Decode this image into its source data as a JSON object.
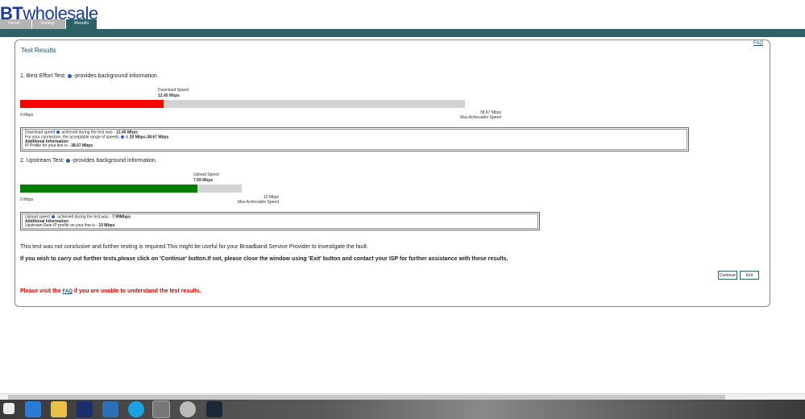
{
  "brand": {
    "prefix": "BT",
    "name": "wholesale"
  },
  "tabs": [
    {
      "label": "Home"
    },
    {
      "label": "Testing"
    },
    {
      "label": "Results"
    }
  ],
  "faq_link": "FAQ",
  "title": "Test Results",
  "best_effort": {
    "heading": "1. Best Effort Test:",
    "heading_suffix": "-provides background information.",
    "speed_label": "Download Speed",
    "speed_value": "12.45 Mbps",
    "min_label": "0 Mbps",
    "max_value": "38.67 Mbps",
    "max_label": "Max Achievable Speed",
    "fill_fraction": 0.322,
    "fill_color": "#ff0000",
    "info": {
      "line1_a": "Download speed",
      "line1_b": "achieved during the test was - ",
      "line1_value": "12.45 Mbps",
      "line2_a": "For your connection, the acceptable range of speeds",
      "line2_b": "is ",
      "line2_value": "20 Mbps-38.67 Mbps",
      "line2_end": " .",
      "additional_label": "Additional Information:",
      "line4": "IP Profile for your line is - ",
      "line4_value": "38.67 Mbps"
    }
  },
  "upstream": {
    "heading": "2. Upstream Test:",
    "heading_suffix": "-provides background information.",
    "speed_label": "Upload Speed",
    "speed_value": "7.99 Mbps",
    "min_label": "0 Mbps",
    "max_value": "10 Mbps",
    "max_label": "Max Achievable Speed",
    "fill_fraction": 0.799,
    "fill_color": "#007f00",
    "info": {
      "line1_a": "Upload speed",
      "line1_b": " achieved during the test was - ",
      "line1_value": "7.99Mbps",
      "additional_label": "Additional Information:",
      "line3": "Upstream Rate IP profile on your line is - ",
      "line3_value": "10 Mbps"
    }
  },
  "message_inconclusive": "This test was not conclusive and further testing is required.This might be useful for your Broadband Service Provider to investigate the fault.",
  "message_instructions": "If you wish to carry out further tests,please click on 'Continue' button.If not, please close the window using 'Exit' button and contact your ISP for further assistance with these results.",
  "buttons": {
    "continue": "Continue",
    "exit": "Exit"
  },
  "help": {
    "prefix": "Please visit the ",
    "link": "FAQ",
    "suffix": " if you are unable to understand the test results."
  },
  "taskbar_icons": [
    "start-icon",
    "internet-explorer-icon",
    "file-explorer-icon",
    "photoshop-icon",
    "media-player-icon",
    "skype-icon",
    "chrome-icon",
    "app-icon",
    "steam-icon"
  ],
  "colors": {
    "accent": "#2e6165",
    "title": "#1d4e6b",
    "warning": "#dd0000"
  }
}
